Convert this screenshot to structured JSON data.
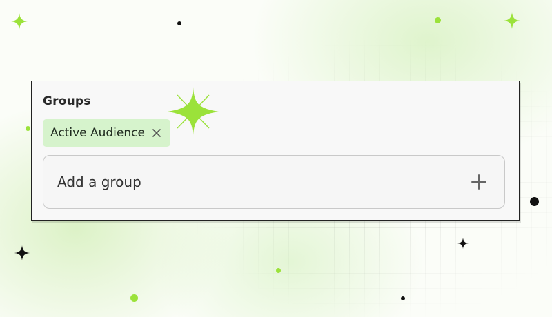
{
  "groups_field": {
    "title": "Groups",
    "chips": [
      {
        "label": "Active Audience",
        "remove_icon": "close-icon"
      }
    ],
    "add_input": {
      "placeholder": "Add a group",
      "action_icon": "plus-icon"
    }
  },
  "colors": {
    "accent": "#9be23a",
    "chip_bg": "#d6f3cc",
    "card_bg": "#f8f8f8"
  }
}
